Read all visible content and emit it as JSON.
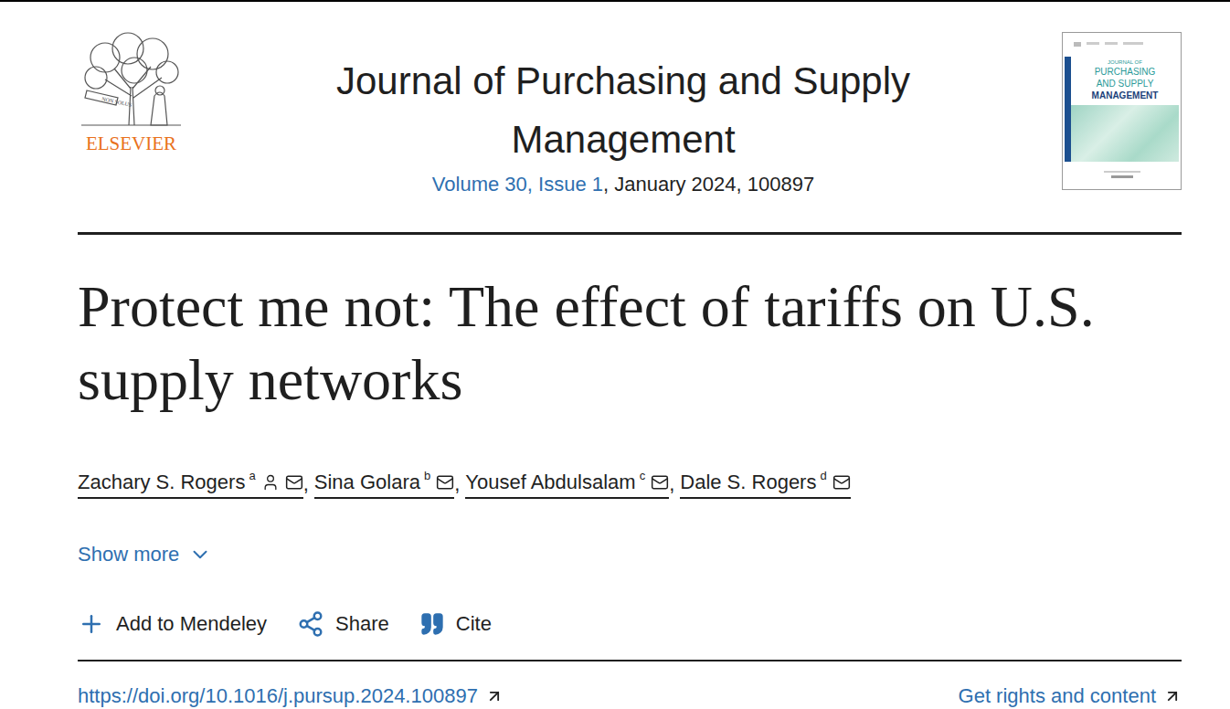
{
  "publisher": {
    "name": "ELSEVIER",
    "motto": "NON SOLUS"
  },
  "journal": {
    "title": "Journal of Purchasing and Supply Management",
    "issue_link": "Volume 30, Issue 1",
    "issue_rest": ", January 2024, 100897"
  },
  "cover": {
    "lines": [
      "JOURNAL OF",
      "PURCHASING",
      "AND SUPPLY",
      "MANAGEMENT"
    ]
  },
  "article": {
    "title": "Protect me not: The effect of tariffs on U.S. supply networks"
  },
  "author_separator": ",",
  "authors": [
    {
      "name": "Zachary S. Rogers",
      "affiliation": "a",
      "corresponding": true
    },
    {
      "name": "Sina Golara",
      "affiliation": "b",
      "corresponding": false
    },
    {
      "name": "Yousef Abdulsalam",
      "affiliation": "c",
      "corresponding": false
    },
    {
      "name": "Dale S. Rogers",
      "affiliation": "d",
      "corresponding": false
    }
  ],
  "show_more": {
    "label": "Show more"
  },
  "actions": [
    {
      "label": "Add to Mendeley"
    },
    {
      "label": "Share"
    },
    {
      "label": "Cite"
    }
  ],
  "doi": "https://doi.org/10.1016/j.pursup.2024.100897",
  "rights": "Get rights and content"
}
